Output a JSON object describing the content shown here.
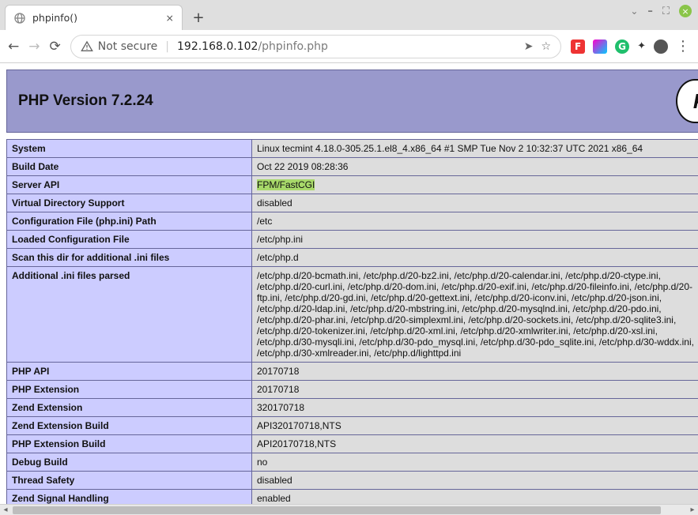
{
  "browser": {
    "tab_title": "phpinfo()",
    "security_label": "Not secure",
    "url_host": "192.168.0.102",
    "url_path": "/phpinfo.php"
  },
  "phpinfo": {
    "header_title": "PHP Version 7.2.24",
    "logo_text": "PH",
    "rows": [
      {
        "k": "System",
        "v": "Linux tecmint 4.18.0-305.25.1.el8_4.x86_64 #1 SMP Tue Nov 2 10:32:37 UTC 2021 x86_64"
      },
      {
        "k": "Build Date",
        "v": "Oct 22 2019 08:28:36"
      },
      {
        "k": "Server API",
        "v": "FPM/FastCGI",
        "highlight": true
      },
      {
        "k": "Virtual Directory Support",
        "v": "disabled"
      },
      {
        "k": "Configuration File (php.ini) Path",
        "v": "/etc"
      },
      {
        "k": "Loaded Configuration File",
        "v": "/etc/php.ini"
      },
      {
        "k": "Scan this dir for additional .ini files",
        "v": "/etc/php.d"
      },
      {
        "k": "Additional .ini files parsed",
        "v": "/etc/php.d/20-bcmath.ini, /etc/php.d/20-bz2.ini, /etc/php.d/20-calendar.ini, /etc/php.d/20-ctype.ini, /etc/php.d/20-curl.ini, /etc/php.d/20-dom.ini, /etc/php.d/20-exif.ini, /etc/php.d/20-fileinfo.ini, /etc/php.d/20-ftp.ini, /etc/php.d/20-gd.ini, /etc/php.d/20-gettext.ini, /etc/php.d/20-iconv.ini, /etc/php.d/20-json.ini, /etc/php.d/20-ldap.ini, /etc/php.d/20-mbstring.ini, /etc/php.d/20-mysqlnd.ini, /etc/php.d/20-pdo.ini, /etc/php.d/20-phar.ini, /etc/php.d/20-simplexml.ini, /etc/php.d/20-sockets.ini, /etc/php.d/20-sqlite3.ini, /etc/php.d/20-tokenizer.ini, /etc/php.d/20-xml.ini, /etc/php.d/20-xmlwriter.ini, /etc/php.d/20-xsl.ini, /etc/php.d/30-mysqli.ini, /etc/php.d/30-pdo_mysql.ini, /etc/php.d/30-pdo_sqlite.ini, /etc/php.d/30-wddx.ini, /etc/php.d/30-xmlreader.ini, /etc/php.d/lighttpd.ini"
      },
      {
        "k": "PHP API",
        "v": "20170718"
      },
      {
        "k": "PHP Extension",
        "v": "20170718"
      },
      {
        "k": "Zend Extension",
        "v": "320170718"
      },
      {
        "k": "Zend Extension Build",
        "v": "API320170718,NTS"
      },
      {
        "k": "PHP Extension Build",
        "v": "API20170718,NTS"
      },
      {
        "k": "Debug Build",
        "v": "no"
      },
      {
        "k": "Thread Safety",
        "v": "disabled"
      },
      {
        "k": "Zend Signal Handling",
        "v": "enabled"
      }
    ]
  }
}
